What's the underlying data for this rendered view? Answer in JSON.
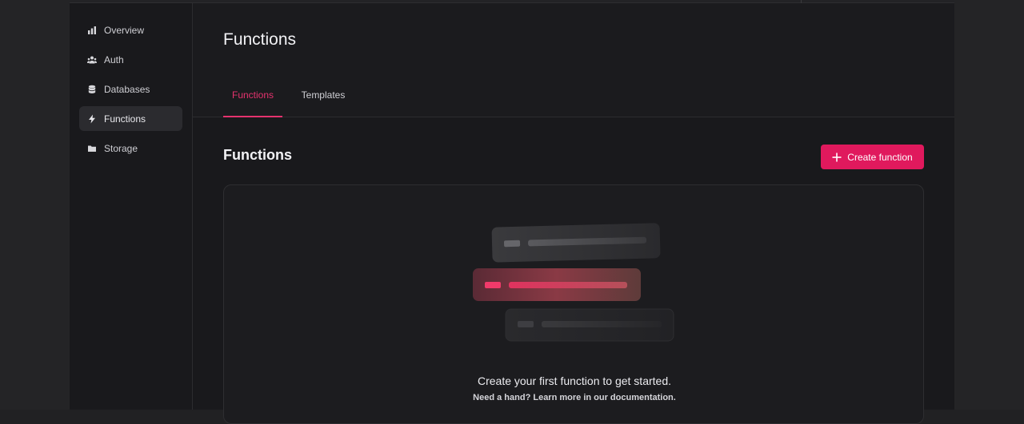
{
  "sidebar": {
    "items": [
      {
        "label": "Overview",
        "icon": "bar-chart-icon",
        "active": false
      },
      {
        "label": "Auth",
        "icon": "users-icon",
        "active": false
      },
      {
        "label": "Databases",
        "icon": "database-icon",
        "active": false
      },
      {
        "label": "Functions",
        "icon": "lightning-icon",
        "active": true
      },
      {
        "label": "Storage",
        "icon": "folder-icon",
        "active": false
      }
    ]
  },
  "header": {
    "title": "Functions",
    "tabs": [
      {
        "label": "Functions",
        "active": true
      },
      {
        "label": "Templates",
        "active": false
      }
    ]
  },
  "content": {
    "section_title": "Functions",
    "create_button_label": "Create function",
    "empty_state": {
      "title": "Create your first function to get started.",
      "subtitle": "Need a hand? Learn more in our documentation."
    }
  },
  "colors": {
    "accent": "#e0195d",
    "background": "#19191c"
  }
}
